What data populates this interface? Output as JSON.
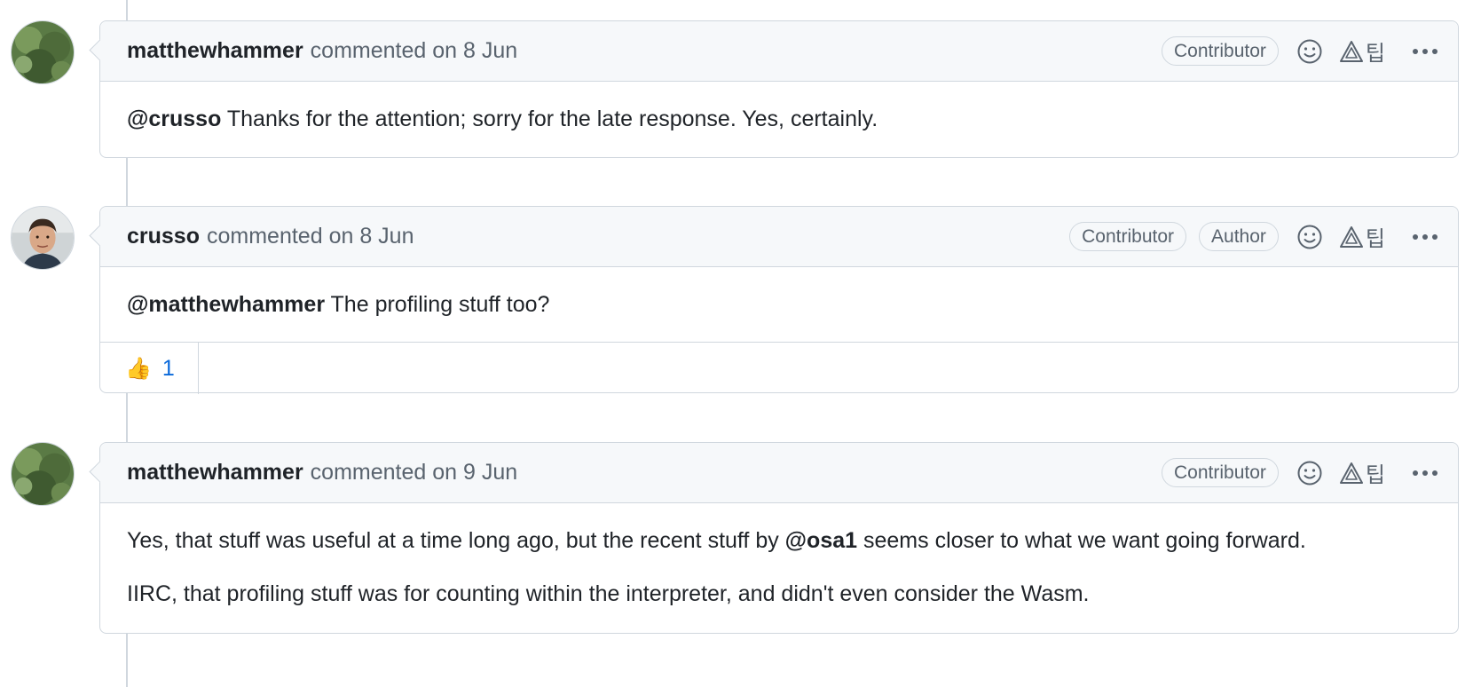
{
  "comments": [
    {
      "author": "matthewhammer",
      "action": "commented",
      "date": "on 8 Jun",
      "badges": [
        "Contributor"
      ],
      "body": [
        {
          "mention": "@crusso",
          "text": " Thanks for the attention; sorry for the late response. Yes, certainly."
        }
      ]
    },
    {
      "author": "crusso",
      "action": "commented",
      "date": "on 8 Jun",
      "badges": [
        "Contributor",
        "Author"
      ],
      "body": [
        {
          "mention": "@matthewhammer",
          "text": " The profiling stuff too?"
        }
      ],
      "reactions": [
        {
          "emoji": "👍",
          "count": "1"
        }
      ]
    },
    {
      "author": "matthewhammer",
      "action": "commented",
      "date": "on 9 Jun",
      "badges": [
        "Contributor"
      ],
      "body": [
        {
          "pre": "Yes, that stuff was useful at a time long ago, but the recent stuff by ",
          "mention": "@osa1",
          "text": " seems closer to what we want going forward."
        },
        {
          "pre": "IIRC, that profiling stuff was for counting within the interpreter, and didn't even consider the Wasm."
        }
      ]
    }
  ],
  "icons": {
    "reaction": "smiley-icon",
    "copilot": "copilot-icon",
    "menu": "kebab-horizontal-icon"
  },
  "colors": {
    "border": "#d0d7de",
    "header_bg": "#f6f8fa",
    "muted_text": "#59636e",
    "link_blue": "#0969da"
  }
}
